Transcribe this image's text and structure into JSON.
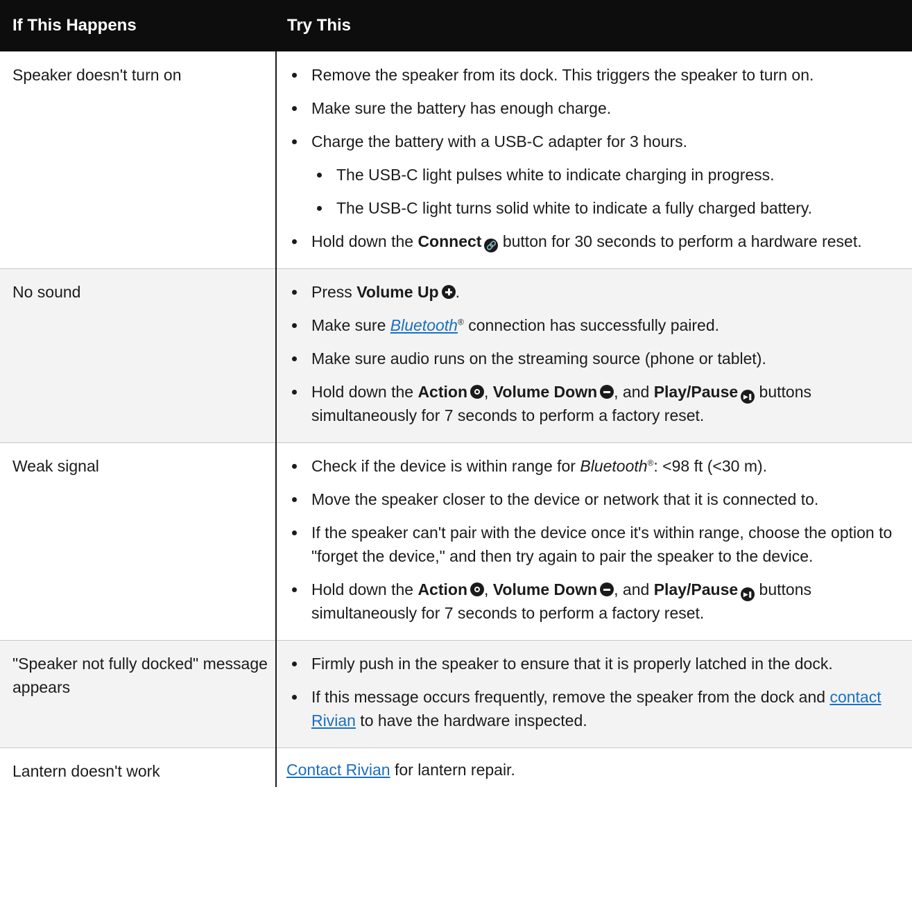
{
  "header": {
    "col1": "If This Happens",
    "col2": "Try This"
  },
  "rows": [
    {
      "issue": "Speaker doesn't turn on",
      "r1": {
        "b1": "Remove the speaker from its dock. This triggers the speaker to turn on.",
        "b2": "Make sure the battery has enough charge.",
        "b3": "Charge the battery with a USB-C adapter for 3 hours.",
        "s1": "The USB-C light pulses white to indicate charging in progress.",
        "s2": "The USB-C light turns solid white to indicate a fully charged battery.",
        "b4_pre": "Hold down the ",
        "b4_bold": "Connect",
        "b4_post": " button for 30 seconds to perform a hardware reset."
      }
    },
    {
      "issue": "No sound",
      "b1_pre": "Press ",
      "b1_bold": "Volume Up",
      "b1_post": ".",
      "b2_pre": "Make sure ",
      "b2_link": "Bluetooth",
      "b2_reg": "®",
      "b2_post": " connection has successfully paired.",
      "b3": "Make sure audio runs on the streaming source (phone or tablet).",
      "b4_pre": "Hold down the ",
      "b4_action": "Action",
      "b4_sep1": ", ",
      "b4_voldown": "Volume Down",
      "b4_sep2": ", and ",
      "b4_play": "Play/Pause",
      "b4_post": " buttons simultaneously for 7 seconds to perform a factory reset."
    },
    {
      "issue": "Weak signal",
      "b1_pre": "Check if the device is within range for ",
      "b1_italic": "Bluetooth",
      "b1_reg": "®",
      "b1_post": ": <98 ft (<30 m).",
      "b2": "Move the speaker closer to the device or network that it is connected to.",
      "b3": "If the speaker can't pair with the device once it's within range, choose the option to \"forget the device,\" and then try again to pair the speaker to the device.",
      "b4_pre": "Hold down the ",
      "b4_action": "Action",
      "b4_sep1": ", ",
      "b4_voldown": "Volume Down",
      "b4_sep2": ", and ",
      "b4_play": "Play/Pause",
      "b4_post": " buttons simultaneously for 7 seconds to perform a factory reset."
    },
    {
      "issue": "\"Speaker not fully docked\" message appears",
      "b1": "Firmly push in the speaker to ensure that it is properly latched in the dock.",
      "b2_pre": "If this message occurs frequently, remove the speaker from the dock and ",
      "b2_link": "contact Rivian",
      "b2_post": " to have the hardware inspected."
    },
    {
      "issue": "Lantern doesn't work",
      "link": "Contact Rivian",
      "post": " for lantern repair."
    }
  ],
  "icons": {
    "connect": "link-icon",
    "volume_up": "plus-circle-icon",
    "volume_down": "minus-circle-icon",
    "action": "dot-circle-icon",
    "play_pause": "play-pause-circle-icon"
  },
  "colors": {
    "header_bg": "#0d0d0d",
    "link": "#1a6fc2",
    "shade_row": "#f3f3f3"
  }
}
